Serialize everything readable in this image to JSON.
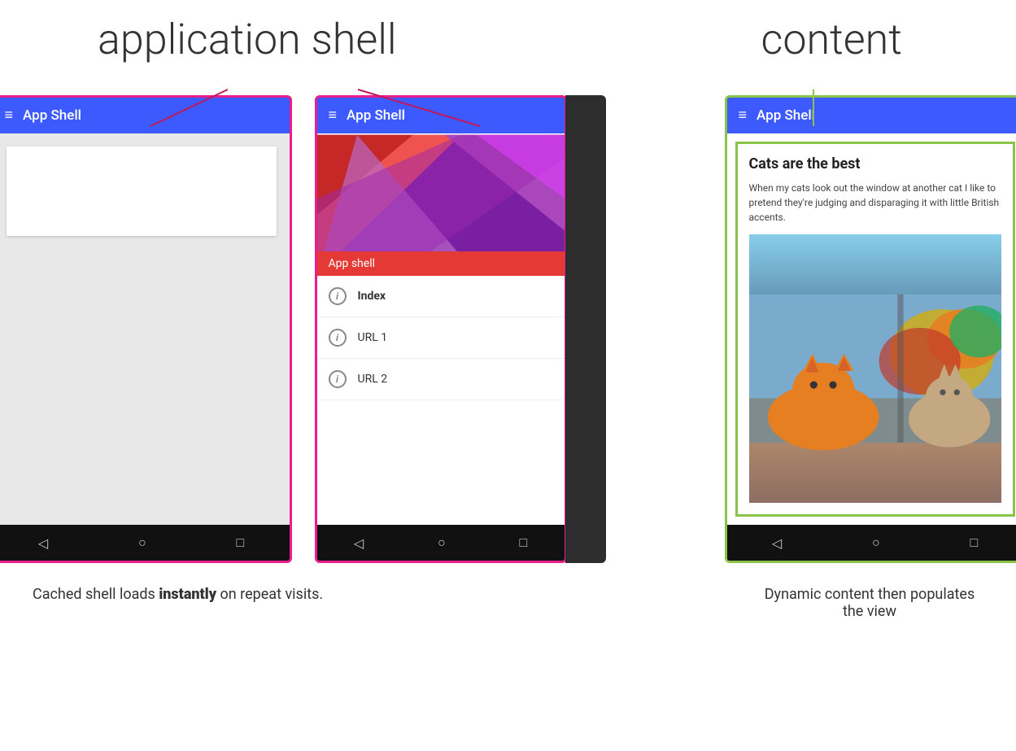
{
  "header": {
    "label_app_shell": "application shell",
    "label_content": "content"
  },
  "phone1": {
    "title": "App Shell",
    "nav_items": [
      "◁",
      "○",
      "□"
    ]
  },
  "phone2": {
    "title": "App Shell",
    "drawer_label": "App shell",
    "menu_items": [
      {
        "label": "Index",
        "bold": true
      },
      {
        "label": "URL 1",
        "bold": false
      },
      {
        "label": "URL 2",
        "bold": false
      }
    ],
    "nav_items": [
      "◁",
      "○",
      "□"
    ]
  },
  "phone3": {
    "title": "App Shell",
    "content_title": "Cats are the best",
    "content_text": "When my cats look out the window at another cat I like to pretend they're judging and disparaging it with little British accents.",
    "nav_items": [
      "◁",
      "○",
      "□"
    ]
  },
  "captions": {
    "left": "Cached shell loads instantly on repeat visits.",
    "left_bold": "instantly",
    "right": "Dynamic content then populates the view"
  },
  "colors": {
    "pink_border": "#e91e8c",
    "green_border": "#8bc34a",
    "blue_nav": "#3d5afe",
    "connector_left": "#c2185b",
    "connector_right": "#8bc34a"
  }
}
